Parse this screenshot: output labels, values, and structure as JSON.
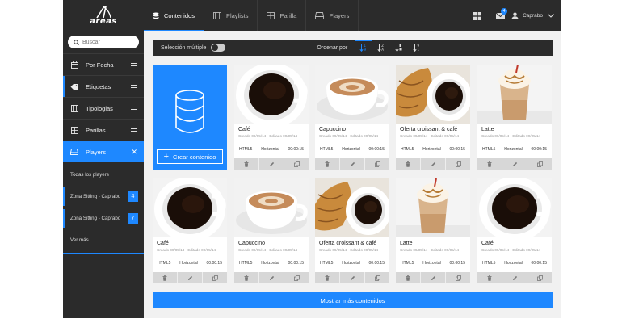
{
  "brand": {
    "logo_text": "areas"
  },
  "search": {
    "placeholder": "Buscar"
  },
  "sidebar": {
    "items": [
      {
        "label": "Por Fecha"
      },
      {
        "label": "Etiquetas"
      },
      {
        "label": "Tipologias"
      },
      {
        "label": "Parillas"
      },
      {
        "label": "Players"
      }
    ],
    "players_sub": [
      {
        "label": "Todas los players"
      },
      {
        "label": "Zona Sitting - Caprabo",
        "badge": "4"
      },
      {
        "label": "Zona Sitting - Caprabo",
        "badge": "7"
      },
      {
        "label": "Ver más ..."
      }
    ]
  },
  "topbar": {
    "tabs": [
      {
        "label": "Contenidos"
      },
      {
        "label": "Playlists"
      },
      {
        "label": "Parilla"
      },
      {
        "label": "Players"
      }
    ],
    "mail_badge": "4",
    "user_name": "Caprabo"
  },
  "toolbar": {
    "multi_select_label": "Selección múltiple",
    "order_label": "Ordenar por"
  },
  "create": {
    "label": "Crear contenido"
  },
  "cards": [
    {
      "title": "Café",
      "created": "Creado 09/05/14",
      "edited": "Editado 09/05/14",
      "format": "HTML5",
      "orientation": "Horizontal",
      "duration": "00:00:15",
      "thumb": "coffee"
    },
    {
      "title": "Capuccino",
      "created": "Creado 09/05/14",
      "edited": "Editado 09/05/14",
      "format": "HTML5",
      "orientation": "Horizontal",
      "duration": "00:00:15",
      "thumb": "cappuccino"
    },
    {
      "title": "Oferta croissant & café",
      "created": "Creado 09/05/14",
      "edited": "Editado 09/05/14",
      "format": "HTML5",
      "orientation": "Horizontal",
      "duration": "00:00:15",
      "thumb": "croissant"
    },
    {
      "title": "Latte",
      "created": "Creado 09/05/14",
      "edited": "Editado 09/05/14",
      "format": "HTML5",
      "orientation": "Horizontal",
      "duration": "00:00:15",
      "thumb": "latte"
    },
    {
      "title": "Café",
      "created": "Creado 09/05/14",
      "edited": "Editado 09/05/14",
      "format": "HTML5",
      "orientation": "Horizontal",
      "duration": "00:00:15",
      "thumb": "coffee"
    },
    {
      "title": "Capuccino",
      "created": "Creado 09/05/14",
      "edited": "Editado 09/05/14",
      "format": "HTML5",
      "orientation": "Horizontal",
      "duration": "00:00:15",
      "thumb": "cappuccino"
    },
    {
      "title": "Oferta croissant & café",
      "created": "Creado 09/05/14",
      "edited": "Editado 09/05/14",
      "format": "HTML5",
      "orientation": "Horizontal",
      "duration": "00:00:15",
      "thumb": "croissant"
    },
    {
      "title": "Latte",
      "created": "Creado 09/05/14",
      "edited": "Editado 09/05/14",
      "format": "HTML5",
      "orientation": "Horizontal",
      "duration": "00:00:15",
      "thumb": "latte"
    },
    {
      "title": "Café",
      "created": "Creado 09/05/14",
      "edited": "Editado 09/05/14",
      "format": "HTML5",
      "orientation": "Horizontal",
      "duration": "00:00:15",
      "thumb": "coffee"
    }
  ],
  "more_button": {
    "label": "Mostrar más contenidos"
  },
  "colors": {
    "accent": "#1e88ff",
    "dark": "#2b2b2b",
    "background": "#f1f1f1"
  }
}
